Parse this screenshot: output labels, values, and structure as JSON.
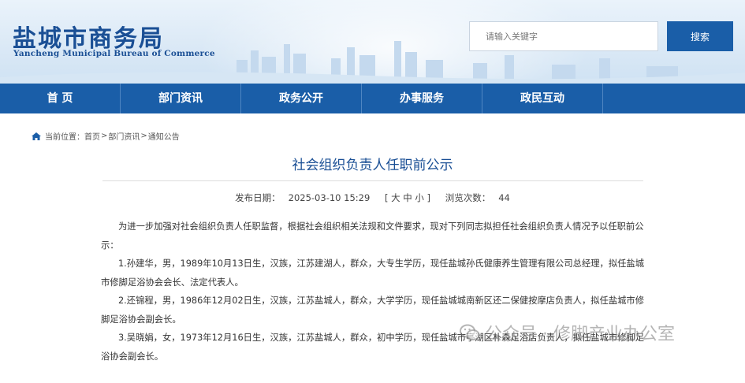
{
  "header": {
    "logo_cn": "盐城市商务局",
    "logo_en": "Yancheng Municipal Bureau of Commerce",
    "search_placeholder": "请输入关键字",
    "search_button": "搜索"
  },
  "nav": {
    "items": [
      {
        "label": "首 页"
      },
      {
        "label": "部门资讯"
      },
      {
        "label": "政务公开"
      },
      {
        "label": "办事服务"
      },
      {
        "label": "政民互动"
      }
    ]
  },
  "breadcrumb": {
    "prefix": "当前位置：",
    "items": [
      "首页",
      "部门资讯",
      "通知公告"
    ],
    "separator": ">"
  },
  "article": {
    "title": "社会组织负责人任职前公示",
    "publish_label": "发布日期：",
    "publish_date": "2025-03-10 15:29",
    "font_size_control": "[ 大 中 小 ]",
    "views_label": "浏览次数：",
    "views_count": "44",
    "paragraphs": [
      "为进一步加强对社会组织负责人任职监督，根据社会组织相关法规和文件要求，现对下列同志拟担任社会组织负责人情况予以任职前公示：",
      "1.孙建华，男，1989年10月13日生，汉族，江苏建湖人，群众，大专生学历，现任盐城孙氏健康养生管理有限公司总经理，拟任盐城市修脚足浴协会会长、法定代表人。",
      "2.还锦程，男，1986年12月02日生，汉族，江苏盐城人，群众，大学学历，现任盐城城南新区还二保健按摩店负责人，拟任盐城市修脚足浴协会副会长。",
      "3.吴晓娟，女，1973年12月16日生，汉族，江苏盐城人，群众，初中学历，现任盐城市亭湖区朴森足浴店负责人，拟任盐城市修脚足浴协会副会长。"
    ]
  },
  "watermark": {
    "text": "公众号 · 修脚产业办公室"
  },
  "colors": {
    "brand_blue": "#1a5ea8",
    "title_blue": "#1a4f95"
  }
}
